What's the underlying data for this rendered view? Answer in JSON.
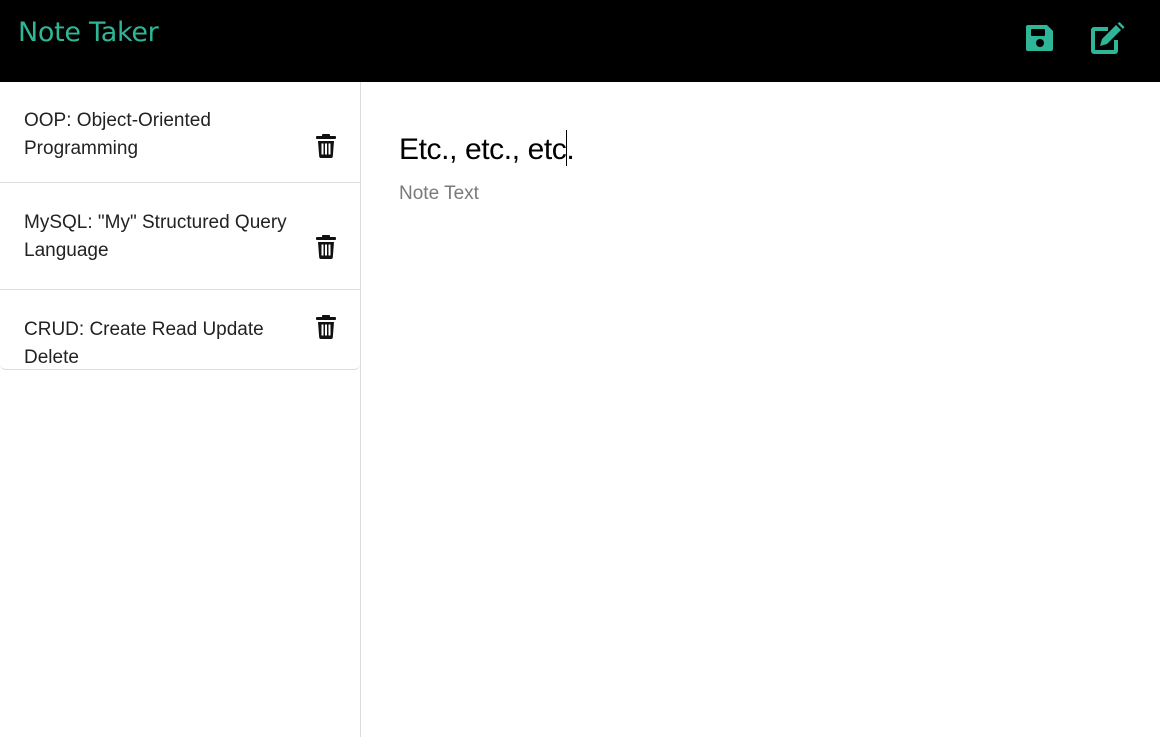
{
  "app": {
    "title": "Note Taker",
    "accent_color": "#2fb597"
  },
  "toolbar": {
    "save_icon": "floppy-disk-icon",
    "new_note_icon": "pencil-square-icon"
  },
  "sidebar": {
    "notes": [
      {
        "title": "OOP: Object-Oriented Programming"
      },
      {
        "title": "MySQL: \"My\" Structured Query Language"
      },
      {
        "title": "CRUD: Create Read Update Delete"
      }
    ],
    "delete_icon": "trash-icon"
  },
  "editor": {
    "title_value": "Etc., etc., etc.",
    "text_placeholder": "Note Text",
    "text_value": ""
  }
}
